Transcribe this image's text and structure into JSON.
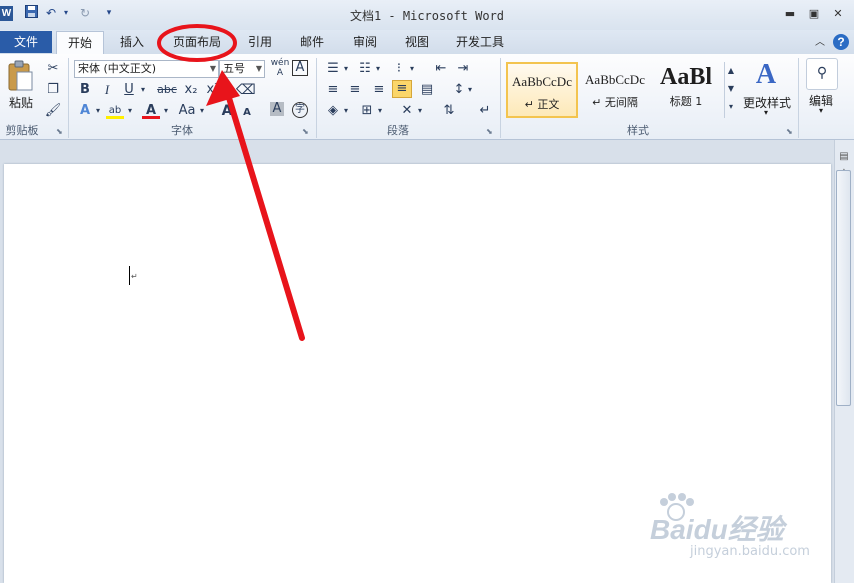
{
  "window": {
    "title": "文档1 - Microsoft Word",
    "app_logo": "W"
  },
  "quick_access": [
    "save-icon",
    "undo-icon",
    "redo-icon",
    "customize-icon"
  ],
  "tabs": [
    {
      "label": "文件"
    },
    {
      "label": "开始"
    },
    {
      "label": "插入"
    },
    {
      "label": "页面布局"
    },
    {
      "label": "引用"
    },
    {
      "label": "邮件"
    },
    {
      "label": "审阅"
    },
    {
      "label": "视图"
    },
    {
      "label": "开发工具"
    }
  ],
  "clipboard": {
    "paste_label": "粘贴",
    "group_label": "剪贴板"
  },
  "font": {
    "family": "宋体 (中文正文)",
    "size": "五号",
    "group_label": "字体",
    "bold": "B",
    "italic": "I",
    "underline": "U",
    "strike": "abc",
    "subscript": "x₂",
    "superscript": "x²",
    "change_case": "Aa",
    "grow": "A",
    "shrink": "A",
    "char_border": "A",
    "enclose": "字",
    "phonetic": "wén",
    "clear": "A"
  },
  "paragraph": {
    "group_label": "段落"
  },
  "styles": {
    "group_label": "样式",
    "items": [
      {
        "preview": "AaBbCcDc",
        "name": "↵ 正文"
      },
      {
        "preview": "AaBbCcDc",
        "name": "↵ 无间隔"
      },
      {
        "preview": "AaBl",
        "name": "标题 1"
      }
    ],
    "change_styles": "更改样式"
  },
  "editing": {
    "label": "编辑"
  },
  "annotation": {
    "color": "#e8141b"
  },
  "watermark": {
    "brand": "Baidu经验",
    "url": "jingyan.baidu.com"
  },
  "colors": {
    "file_tab": "#2a5ca8",
    "accent": "#e8141b"
  }
}
